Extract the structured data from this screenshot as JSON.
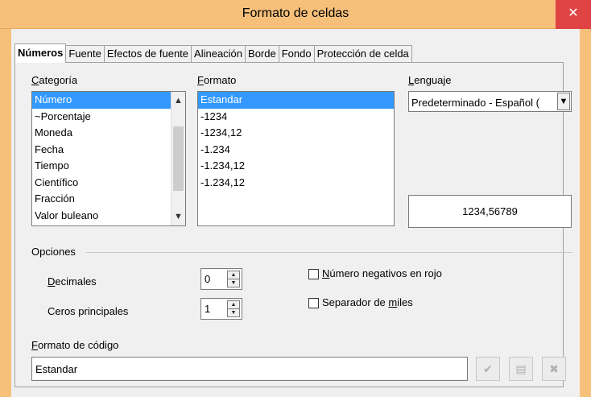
{
  "window": {
    "title": "Formato de celdas",
    "close_glyph": "✕"
  },
  "tabs": [
    {
      "label": "Números",
      "active": true
    },
    {
      "label": "Fuente",
      "active": false
    },
    {
      "label": "Efectos de fuente",
      "active": false
    },
    {
      "label": "Alineación",
      "active": false
    },
    {
      "label": "Borde",
      "active": false
    },
    {
      "label": "Fondo",
      "active": false
    },
    {
      "label": "Protección de celda",
      "active": false
    }
  ],
  "categoria": {
    "label_first": "C",
    "label_rest": "ategoría",
    "items": [
      "Número",
      "~Porcentaje",
      "Moneda",
      "Fecha",
      "Tiempo",
      "Científico",
      "Fracción",
      "Valor buleano"
    ],
    "selected_index": 0
  },
  "formato": {
    "label_first": "F",
    "label_rest": "ormato",
    "items": [
      "Estandar",
      "-1234",
      "-1234,12",
      "-1.234",
      "-1.234,12",
      "-1.234,12"
    ],
    "selected_index": 0
  },
  "lenguaje": {
    "label_first": "L",
    "label_rest": "enguaje",
    "value": "Predeterminado - Español ("
  },
  "preview": {
    "value": "1234,56789"
  },
  "opciones": {
    "heading": "Opciones",
    "decimales": {
      "label_first": "D",
      "label_rest": "ecimales",
      "value": "0"
    },
    "ceros": {
      "label": "Ceros principales",
      "value": "1"
    },
    "negativos": {
      "label_first": "N",
      "label_rest": "úmero negativos en rojo",
      "checked": false
    },
    "separador": {
      "label_before": "Separador de ",
      "label_u": "m",
      "label_after": "iles",
      "checked": false
    }
  },
  "codigo": {
    "label_first": "F",
    "label_rest": "ormato de código",
    "value": "Estandar"
  },
  "icons": {
    "apply": "check-icon",
    "edit_comment": "comment-icon",
    "delete": "delete-icon"
  }
}
